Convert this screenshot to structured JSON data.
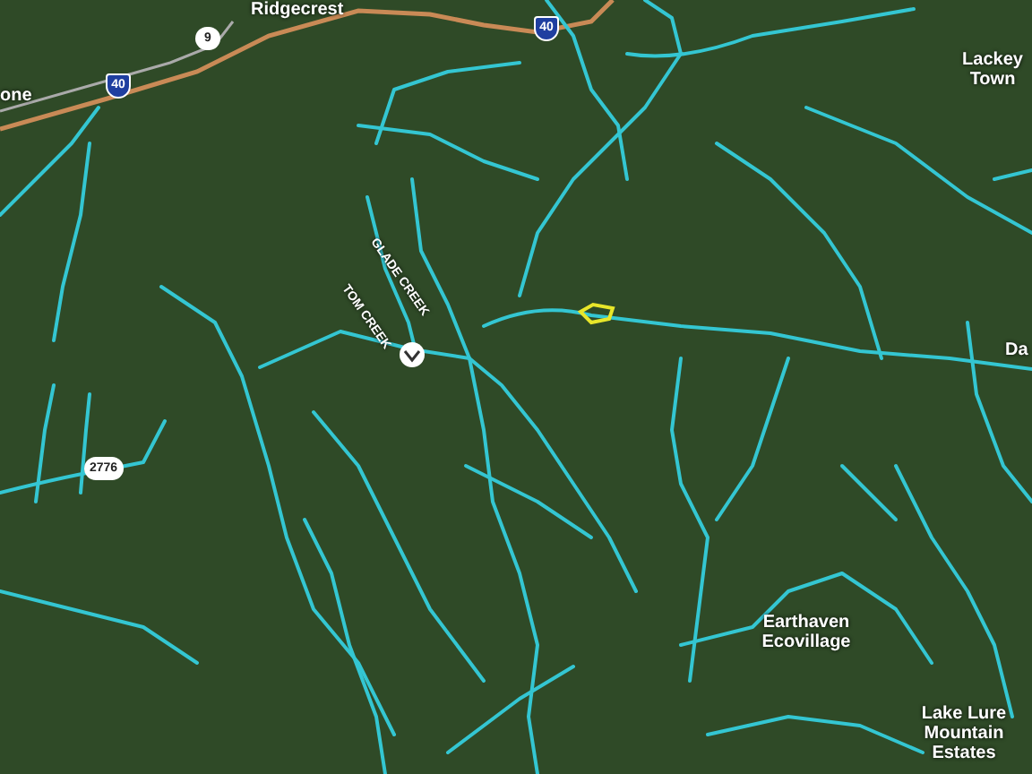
{
  "map": {
    "labels": [
      {
        "kind": "place",
        "text": "Ridgecrest"
      },
      {
        "kind": "place",
        "text": "one"
      },
      {
        "kind": "place",
        "text": "Lackey Town"
      },
      {
        "kind": "place",
        "text": "Da"
      },
      {
        "kind": "place",
        "text": "Earthaven Ecovillage"
      },
      {
        "kind": "place",
        "text": "Lake Lure Mountain Estates"
      },
      {
        "kind": "stream",
        "text": "GLADE CREEK"
      },
      {
        "kind": "stream",
        "text": "TOM CREEK"
      },
      {
        "kind": "interstate",
        "text": "40"
      },
      {
        "kind": "interstate",
        "text": "40"
      },
      {
        "kind": "route",
        "text": "9"
      },
      {
        "kind": "route",
        "text": "2776"
      }
    ]
  }
}
